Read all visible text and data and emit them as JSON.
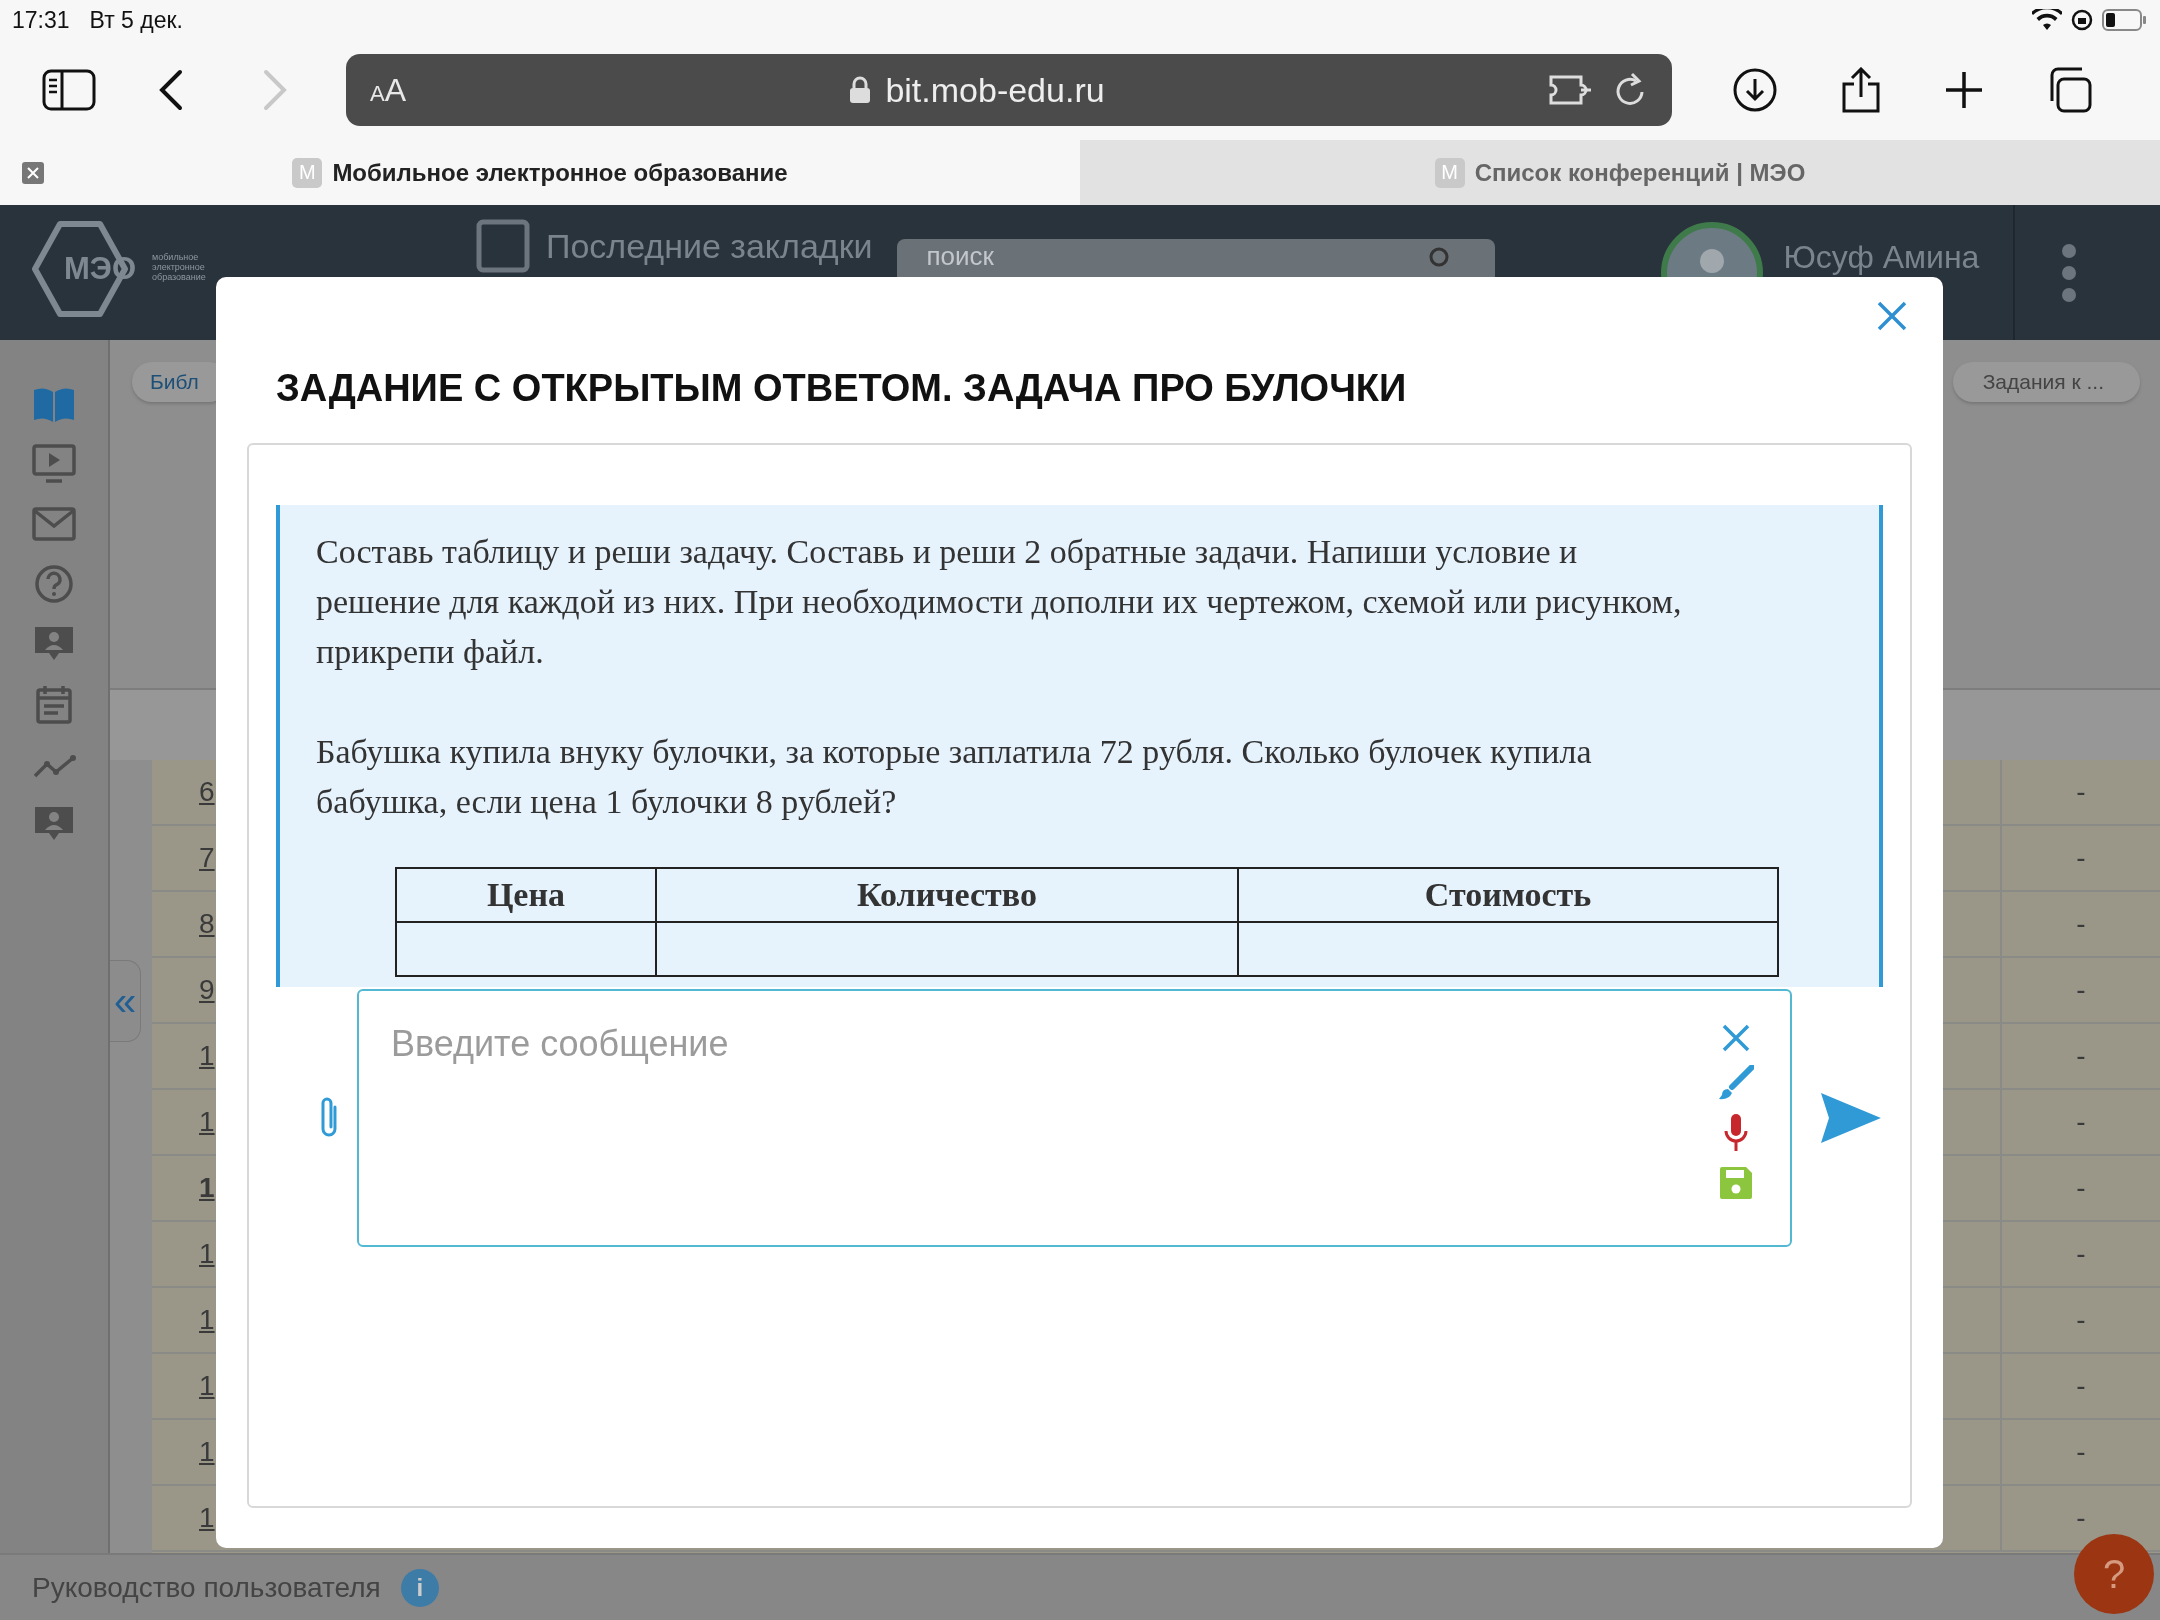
{
  "status_bar": {
    "time": "17:31",
    "date": "Вт 5 дек."
  },
  "browser": {
    "text_size": "AA",
    "address": "bit.mob-edu.ru",
    "forward_enabled": false,
    "tabs": [
      {
        "favicon": "M",
        "title": "Мобильное электронное образование",
        "selected": true
      },
      {
        "favicon": "M",
        "title": "Список конференций | МЭО",
        "selected": false
      }
    ]
  },
  "app_header": {
    "logo": "МЭО",
    "logo_caption": "мобильное электронное образование",
    "bookmarks": "Последние закладки",
    "search_placeholder": "поиск",
    "user": "Юсуф Амина"
  },
  "sidebar": {
    "items": [
      {
        "kind": "book",
        "selected": true
      },
      {
        "kind": "video",
        "selected": false
      },
      {
        "kind": "mail",
        "selected": false
      },
      {
        "kind": "help",
        "selected": false
      },
      {
        "kind": "person",
        "selected": false
      },
      {
        "kind": "calendar",
        "selected": false
      },
      {
        "kind": "chart",
        "selected": false
      },
      {
        "kind": "person",
        "selected": false
      }
    ],
    "collapse": "«"
  },
  "breadcrumbs": [
    "Библ",
    "Задания к ..."
  ],
  "background_table": {
    "rows": [
      {
        "number": "6",
        "bold": false,
        "value": "-"
      },
      {
        "number": "7",
        "bold": false,
        "value": "-"
      },
      {
        "number": "8",
        "bold": false,
        "value": "-"
      },
      {
        "number": "9",
        "bold": false,
        "value": "-"
      },
      {
        "number": "1",
        "bold": false,
        "value": "-"
      },
      {
        "number": "1",
        "bold": false,
        "value": "-"
      },
      {
        "number": "1",
        "bold": true,
        "value": "-"
      },
      {
        "number": "1",
        "bold": false,
        "value": "-"
      },
      {
        "number": "1",
        "bold": false,
        "value": "-"
      },
      {
        "number": "1",
        "bold": false,
        "value": "-"
      },
      {
        "number": "1",
        "bold": false,
        "value": "-"
      },
      {
        "number": "1",
        "bold": false,
        "value": "-"
      }
    ]
  },
  "footer": {
    "guide": "Руководство пользователя",
    "info": "i",
    "help": "?"
  },
  "modal": {
    "title": "ЗАДАНИЕ С ОТКРЫТЫМ ОТВЕТОМ. ЗАДАЧА ПРО БУЛОЧКИ",
    "task_text": [
      "Составь таблицу и реши задачу. Составь и реши 2 обратные задачи. Напиши условие и решение для каждой из них. При необходимости дополни их чертежом, схемой или рисунком, прикрепи файл.",
      "Бабушка купила внуку булочки, за которые заплатила 72 рубля. Сколько булочек купила бабушка, если цена 1 булочки 8 рублей?"
    ],
    "table": {
      "columns": [
        "Цена",
        "Количество",
        "Стоимость"
      ]
    },
    "message": {
      "placeholder": "Введите сообщение"
    }
  }
}
